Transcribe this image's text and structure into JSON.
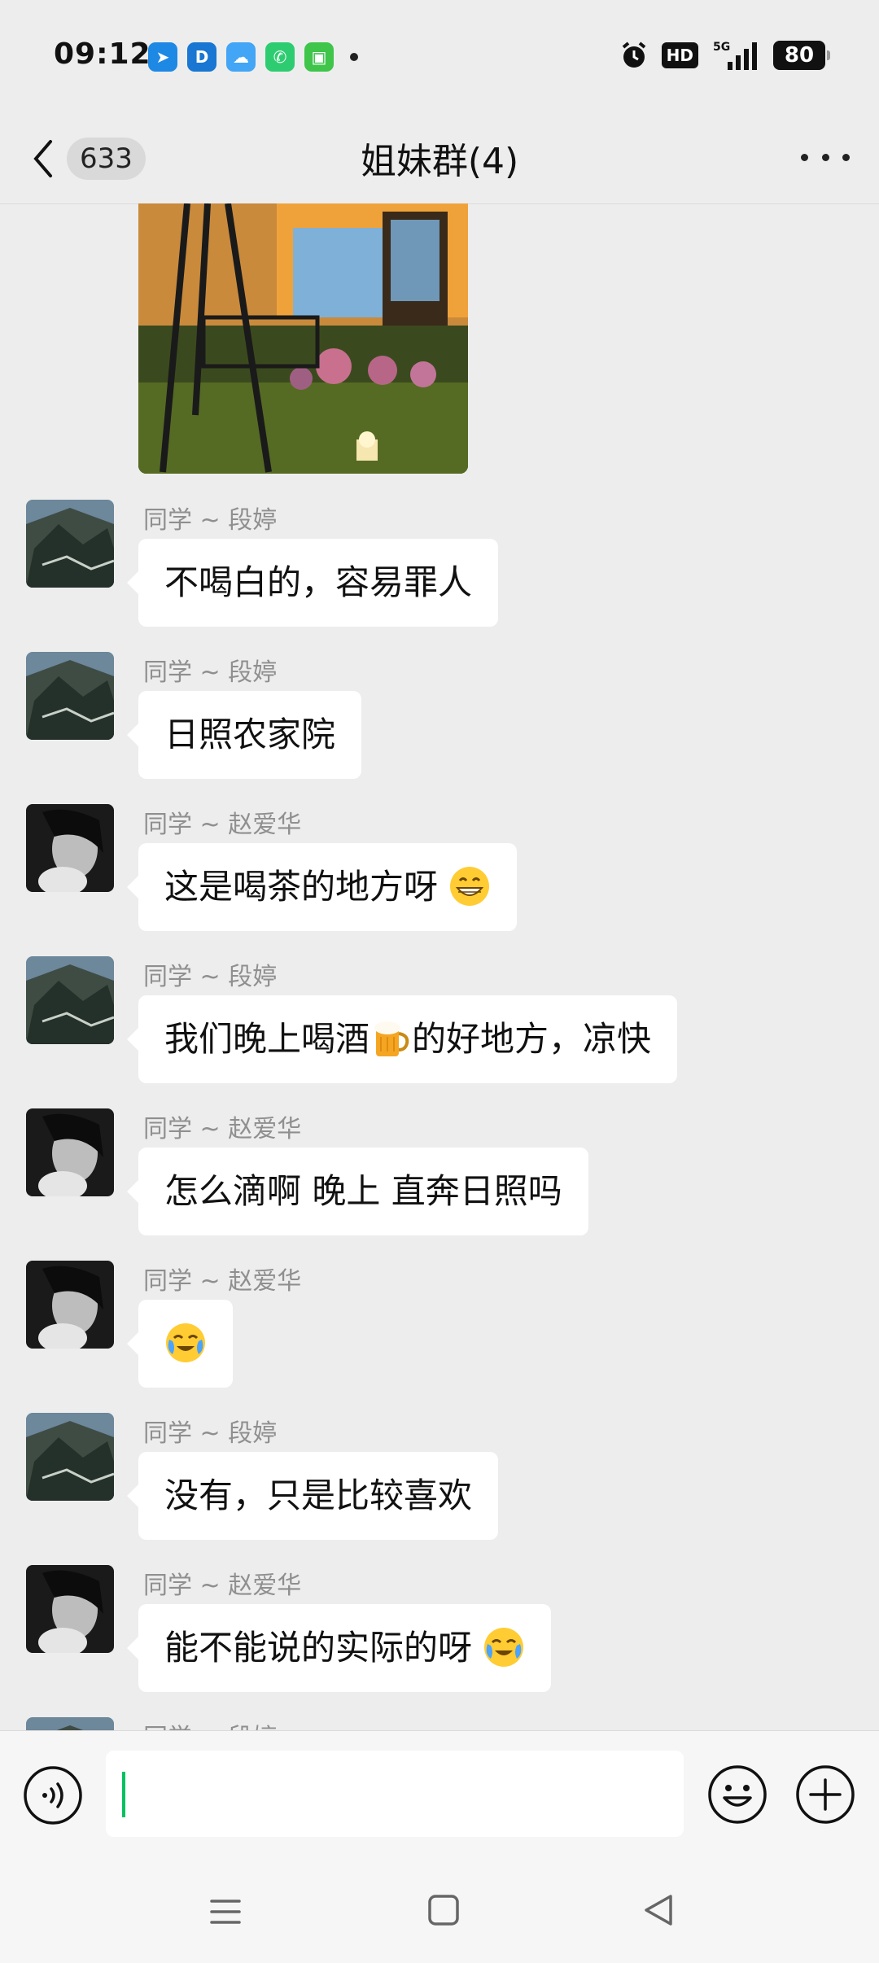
{
  "status_bar": {
    "time": "09:12",
    "hd": "HD",
    "network": "5G",
    "battery": "80"
  },
  "header": {
    "unread_count": "633",
    "title": "姐妹群(4)"
  },
  "messages": [
    {
      "sender": "同学 ~ 段婷",
      "avatar": "tree-avatar",
      "text": "不喝白的，容易罪人"
    },
    {
      "sender": "同学 ~ 段婷",
      "avatar": "tree-avatar",
      "text": "日照农家院"
    },
    {
      "sender": "同学 ~ 赵爱华",
      "avatar": "woman-avatar",
      "text": "这是喝茶的地方呀",
      "emoji_after": "grin-emoji"
    },
    {
      "sender": "同学 ~ 段婷",
      "avatar": "tree-avatar",
      "text_before": "我们晚上喝酒",
      "emoji_mid": "beer-emoji",
      "text_after": "的好地方，凉快"
    },
    {
      "sender": "同学 ~ 赵爱华",
      "avatar": "woman-avatar",
      "text": "怎么滴啊 晚上 直奔日照吗"
    },
    {
      "sender": "同学 ~ 赵爱华",
      "avatar": "woman-avatar",
      "emoji_only": "laugh-cry-emoji"
    },
    {
      "sender": "同学 ~ 段婷",
      "avatar": "tree-avatar",
      "text": "没有，只是比较喜欢"
    },
    {
      "sender": "同学 ~ 赵爱华",
      "avatar": "woman-avatar",
      "text": "能不能说的实际的呀",
      "emoji_after": "laugh-cry-emoji"
    },
    {
      "sender": "同学 ~ 段婷",
      "avatar": "tree-avatar",
      "partial": true
    }
  ],
  "input": {
    "value": "",
    "placeholder": ""
  },
  "colors": {
    "background": "#ededed",
    "bubble": "#ffffff",
    "accent": "#07c160"
  }
}
